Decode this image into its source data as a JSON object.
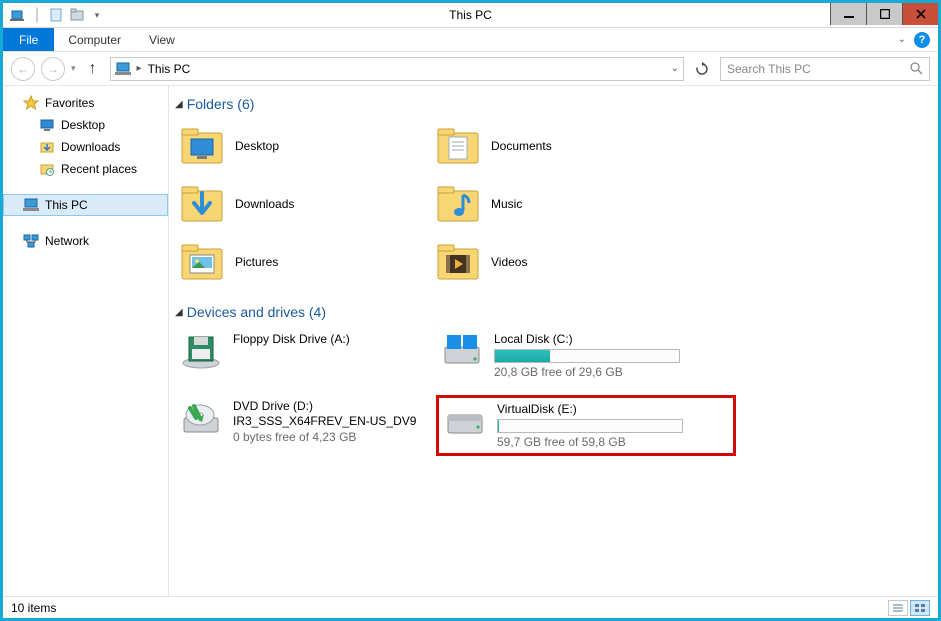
{
  "window": {
    "title": "This PC"
  },
  "menu": {
    "file": "File",
    "computer": "Computer",
    "view": "View"
  },
  "address": {
    "location": "This PC"
  },
  "search": {
    "placeholder": "Search This PC"
  },
  "sidebar": {
    "favorites_label": "Favorites",
    "favorites": {
      "desktop": "Desktop",
      "downloads": "Downloads",
      "recent": "Recent places"
    },
    "this_pc_label": "This PC",
    "network_label": "Network"
  },
  "sections": {
    "folders_header": "Folders (6)",
    "drives_header": "Devices and drives (4)"
  },
  "folders": {
    "desktop": "Desktop",
    "documents": "Documents",
    "downloads": "Downloads",
    "music": "Music",
    "pictures": "Pictures",
    "videos": "Videos"
  },
  "drives": {
    "floppy": {
      "title": "Floppy Disk Drive (A:)"
    },
    "c": {
      "title": "Local Disk (C:)",
      "free": "20,8 GB free of 29,6 GB",
      "fill_pct": 30
    },
    "dvd": {
      "title": "DVD Drive (D:)",
      "sub1": "IR3_SSS_X64FREV_EN-US_DV9",
      "sub2": "0 bytes free of 4,23 GB"
    },
    "e": {
      "title": "VirtualDisk (E:)",
      "free": "59,7 GB free of 59,8 GB",
      "fill_pct": 0.5
    }
  },
  "status": {
    "items": "10 items"
  }
}
